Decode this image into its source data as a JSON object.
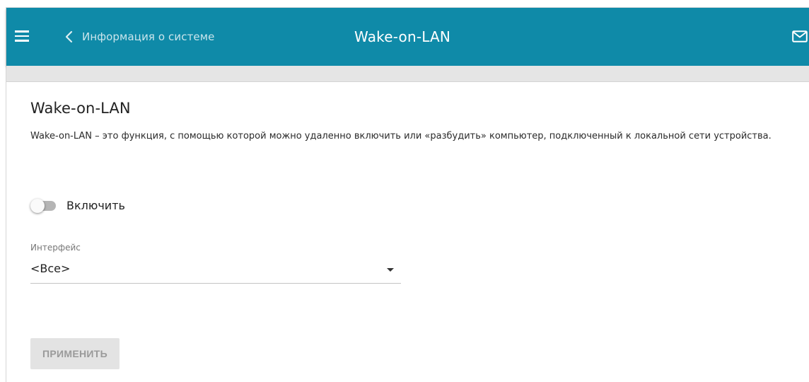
{
  "header": {
    "back_label": "Информация о системе",
    "title": "Wake-on-LAN",
    "menu_icon": "hamburger-menu-icon",
    "back_icon": "chevron-left-icon",
    "notifications_icon": "mail-icon",
    "background_color": "#0f8aa8"
  },
  "main": {
    "heading": "Wake-on-LAN",
    "description": "Wake-on-LAN – это функция, с помощью которой можно удаленно включить или «разбудить» компьютер, подключенный к локальной сети устройства.",
    "enable_toggle": {
      "label": "Включить",
      "checked": false
    },
    "interface_field": {
      "label": "Интерфейс",
      "value": "<Все>"
    },
    "apply_button": {
      "label": "ПРИМЕНИТЬ",
      "disabled": true
    }
  }
}
